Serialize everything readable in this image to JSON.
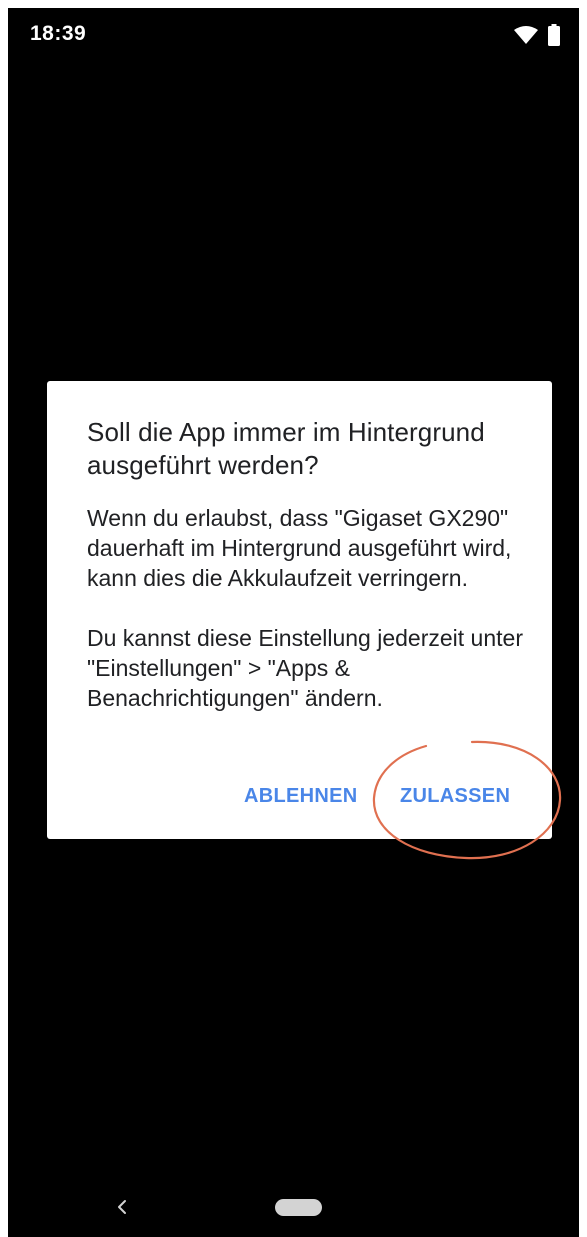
{
  "status_bar": {
    "time": "18:39",
    "wifi_icon": "wifi-icon",
    "battery_icon": "battery-icon"
  },
  "dialog": {
    "title": "Soll die App immer im Hintergrund ausgeführt werden?",
    "body_paragraph_1": "Wenn du erlaubst, dass \"Gigaset GX290\" dauerhaft im Hintergrund ausgeführt wird, kann dies die Akkulaufzeit verringern.",
    "body_paragraph_2": "Du kannst diese Einstellung jederzeit unter \"Einstellungen\" > \"Apps & Benachrichtigungen\" ändern.",
    "deny_label": "ABLEHNEN",
    "allow_label": "ZULASSEN"
  },
  "nav_bar": {
    "back_icon": "chevron-left-icon",
    "home_icon": "home-pill-icon"
  },
  "colors": {
    "accent": "#4a86e8",
    "highlight": "#e07050",
    "background": "#000000",
    "dialog_background": "#ffffff"
  }
}
